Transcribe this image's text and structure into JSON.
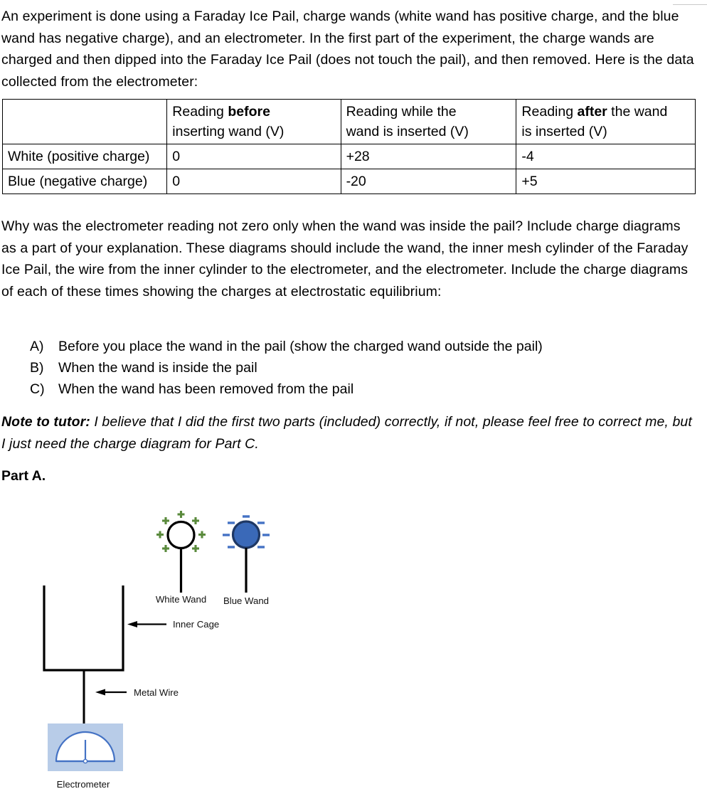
{
  "document": {
    "intro_paragraph": "An experiment is done using a Faraday Ice Pail, charge wands (white wand has positive charge, and the blue wand has negative charge), and an electrometer. In the first part of the experiment, the charge wands are charged and then dipped into the Faraday Ice Pail (does not touch the pail), and then removed. Here is the data collected from the electrometer:",
    "question_paragraph": "Why was the electrometer reading not zero only when the wand was inside the pail? Include charge diagrams as a part of your explanation. These diagrams should include the wand, the inner mesh cylinder of the Faraday Ice Pail, the wire from the inner cylinder to the electrometer, and the electrometer. Include the charge diagrams of each of these times showing the charges at electrostatic equilibrium:",
    "part_a_heading": "Part A."
  },
  "table": {
    "headers": {
      "corner": "",
      "before": {
        "line1_prefix": "Reading ",
        "line1_bold": "before",
        "line2": "inserting wand (V)"
      },
      "during": {
        "line1_prefix": "Reading while the",
        "line1_bold": "",
        "line2": "wand is inserted (V)"
      },
      "after": {
        "line1_prefix": "Reading ",
        "line1_bold": "after",
        "line1_suffix": " the wand",
        "line2": "is inserted (V)"
      }
    },
    "rows": [
      {
        "label": "White (positive charge)",
        "before": "0",
        "during": "+28",
        "after": "-4"
      },
      {
        "label": "Blue (negative charge)",
        "before": "0",
        "during": "-20",
        "after": "+5"
      }
    ]
  },
  "list": {
    "items": [
      {
        "marker": "A)",
        "text": "Before you place the wand in the pail (show the charged wand outside the pail)"
      },
      {
        "marker": "B)",
        "text": "When the wand is inside the pail"
      },
      {
        "marker": "C)",
        "text": "When the wand has been removed from the pail"
      }
    ]
  },
  "note": {
    "label": "Note to tutor:",
    "text": " I believe that I did the first two parts (included) correctly, if not, please feel free to correct me, but I just need the charge diagram for Part C."
  },
  "diagram": {
    "labels": {
      "white_wand": "White Wand",
      "blue_wand": "Blue Wand",
      "inner_cage": "Inner Cage",
      "metal_wire": "Metal Wire",
      "electrometer": "Electrometer"
    },
    "charges": {
      "white_wand_sign": "+",
      "white_wand_count": 8,
      "blue_wand_sign": "–",
      "blue_wand_count": 8
    },
    "colors": {
      "plus_green": "#5a8a3c",
      "wand_blue_fill": "#3a69b8",
      "wand_blue_stroke": "#1f3864",
      "minus_blue": "#4472c4",
      "electrometer_panel": "#b8cce8",
      "electrometer_dial": "#4472c4",
      "outline_black": "#000000"
    }
  }
}
